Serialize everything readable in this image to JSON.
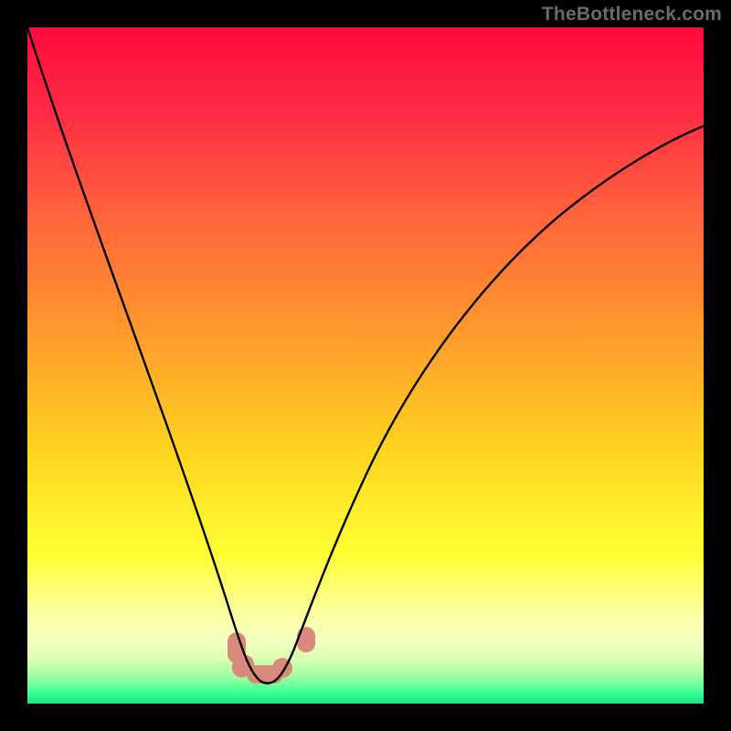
{
  "watermark": "TheBottleneck.com",
  "chart_data": {
    "type": "line",
    "title": "",
    "xlabel": "",
    "ylabel": "",
    "xlim": [
      0,
      100
    ],
    "ylim": [
      0,
      100
    ],
    "grid": false,
    "legend": false,
    "background_gradient": {
      "type": "vertical",
      "stops": [
        {
          "pos": 0.0,
          "color": "#ff0a3a"
        },
        {
          "pos": 0.12,
          "color": "#ff2a45"
        },
        {
          "pos": 0.28,
          "color": "#ff643b"
        },
        {
          "pos": 0.45,
          "color": "#ff9a2d"
        },
        {
          "pos": 0.62,
          "color": "#ffd21f"
        },
        {
          "pos": 0.78,
          "color": "#ffff33"
        },
        {
          "pos": 0.86,
          "color": "#fdff9a"
        },
        {
          "pos": 0.905,
          "color": "#f5ffc2"
        },
        {
          "pos": 0.935,
          "color": "#d9ffb0"
        },
        {
          "pos": 0.965,
          "color": "#8effa0"
        },
        {
          "pos": 0.985,
          "color": "#38ff93"
        },
        {
          "pos": 1.0,
          "color": "#1bdf88"
        }
      ]
    },
    "series": [
      {
        "name": "bottleneck-curve",
        "color": "#000000",
        "x": [
          0,
          3,
          6,
          9,
          12,
          15,
          18,
          21,
          24,
          26,
          28,
          30,
          32,
          33.5,
          35,
          36.5,
          38,
          40,
          42,
          44,
          47,
          50,
          54,
          58,
          63,
          68,
          74,
          80,
          87,
          94,
          100
        ],
        "y": [
          100,
          90,
          80,
          70,
          60,
          50.5,
          41.5,
          33,
          25,
          19.5,
          14.5,
          10,
          6.5,
          4.2,
          2.7,
          2.2,
          3.0,
          5.5,
          9.5,
          14.5,
          21.5,
          28.5,
          36.5,
          43.5,
          51,
          57.5,
          63.5,
          68.5,
          73,
          76.5,
          78.5
        ]
      }
    ],
    "highlight_points": {
      "color": "#d98a7a",
      "points_x": [
        30,
        31.5,
        33.5,
        36,
        40.5
      ],
      "points_y": [
        10,
        6,
        4,
        5,
        11
      ]
    }
  }
}
